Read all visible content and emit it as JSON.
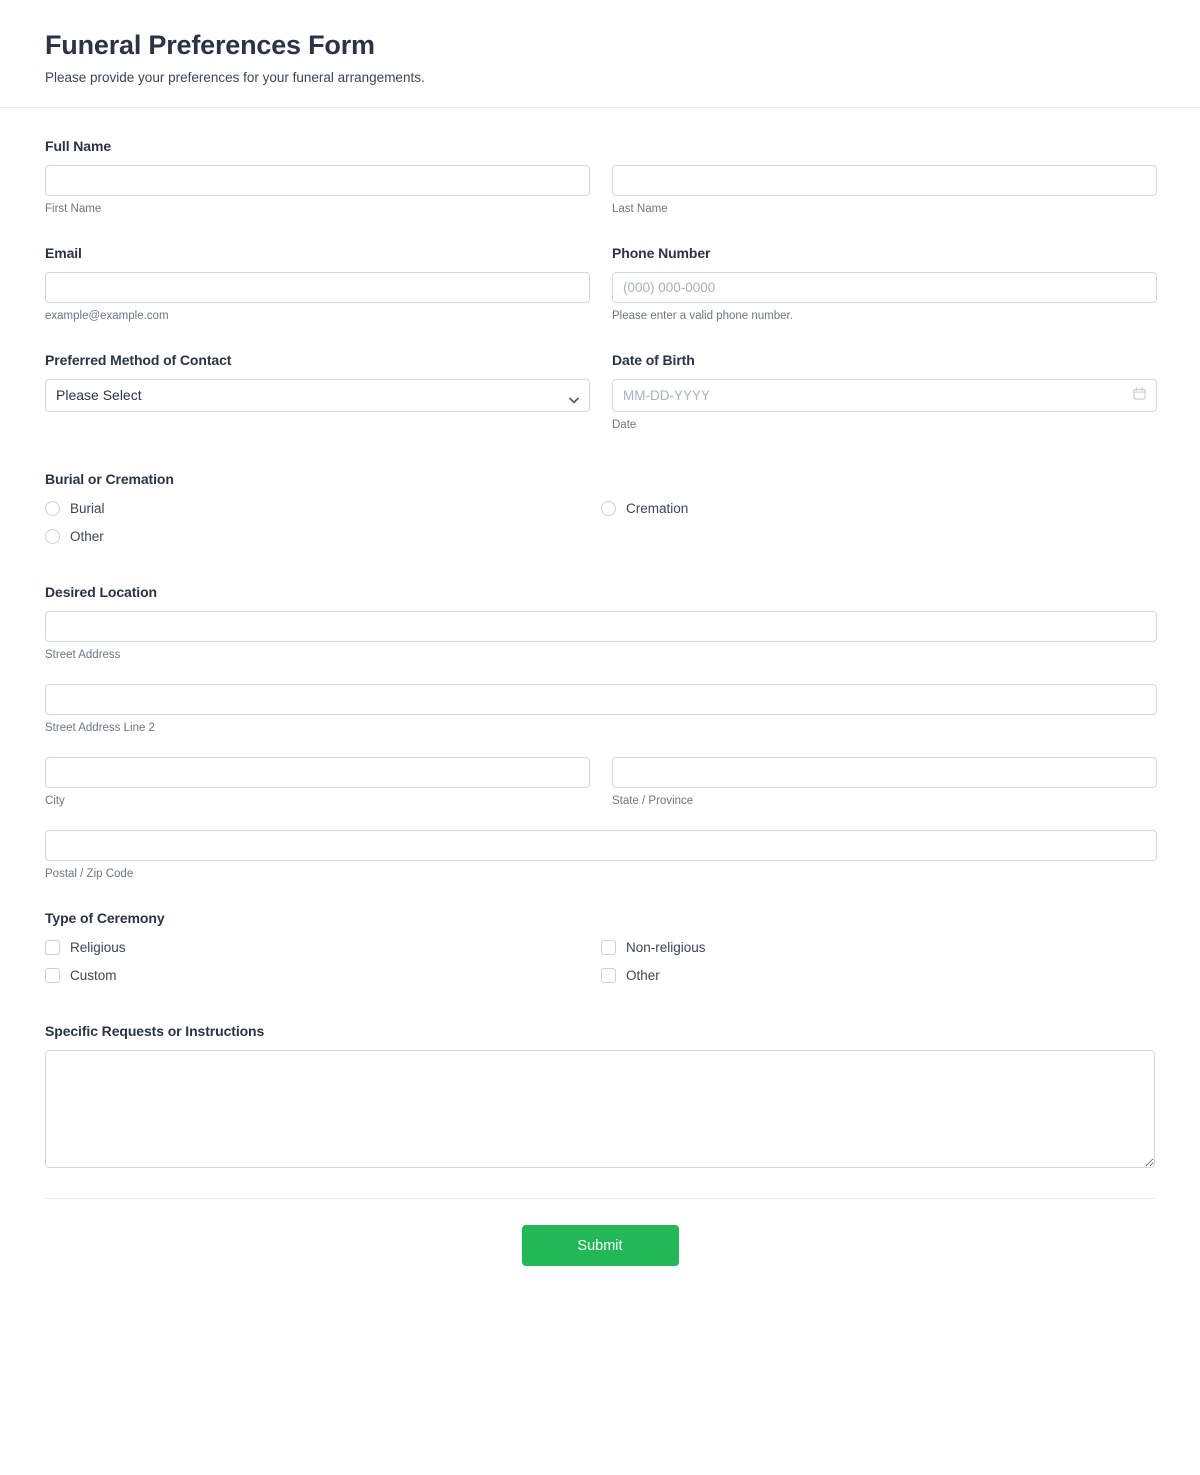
{
  "header": {
    "title": "Funeral Preferences Form",
    "subtitle": "Please provide your preferences for your funeral arrangements."
  },
  "fields": {
    "full_name": {
      "label": "Full Name",
      "first": {
        "sub_label": "First Name",
        "value": "",
        "placeholder": ""
      },
      "last": {
        "sub_label": "Last Name",
        "value": "",
        "placeholder": ""
      }
    },
    "email": {
      "label": "Email",
      "sub_label": "example@example.com",
      "value": "",
      "placeholder": ""
    },
    "phone": {
      "label": "Phone Number",
      "sub_label": "Please enter a valid phone number.",
      "value": "",
      "placeholder": "(000) 000-0000"
    },
    "contact_method": {
      "label": "Preferred Method of Contact",
      "selected": "Please Select",
      "options": [
        "Please Select"
      ],
      "icon": "chevron-down-icon"
    },
    "date_of_birth": {
      "label": "Date of Birth",
      "sub_label": "Date",
      "value": "",
      "placeholder": "MM-DD-YYYY",
      "icon": "calendar-icon"
    },
    "burial_or_cremation": {
      "label": "Burial or Cremation",
      "type": "radio",
      "options": [
        {
          "label": "Burial",
          "checked": false
        },
        {
          "label": "Cremation",
          "checked": false
        },
        {
          "label": "Other",
          "checked": false
        }
      ]
    },
    "desired_location": {
      "label": "Desired Location",
      "street_address": {
        "sub_label": "Street Address",
        "value": "",
        "placeholder": ""
      },
      "street_address_2": {
        "sub_label": "Street Address Line 2",
        "value": "",
        "placeholder": ""
      },
      "city": {
        "sub_label": "City",
        "value": "",
        "placeholder": ""
      },
      "state": {
        "sub_label": "State / Province",
        "value": "",
        "placeholder": ""
      },
      "postal": {
        "sub_label": "Postal / Zip Code",
        "value": "",
        "placeholder": ""
      }
    },
    "ceremony_type": {
      "label": "Type of Ceremony",
      "type": "checkbox",
      "options": [
        {
          "label": "Religious",
          "checked": false
        },
        {
          "label": "Non-religious",
          "checked": false
        },
        {
          "label": "Custom",
          "checked": false
        },
        {
          "label": "Other",
          "checked": false
        }
      ]
    },
    "specific_requests": {
      "label": "Specific Requests or Instructions",
      "value": "",
      "placeholder": ""
    }
  },
  "footer": {
    "submit_label": "Submit"
  },
  "colors": {
    "submit_green": "#22b858",
    "text_dark": "#2c3345",
    "text_muted": "#6f7586",
    "border": "#d5d7e0"
  }
}
